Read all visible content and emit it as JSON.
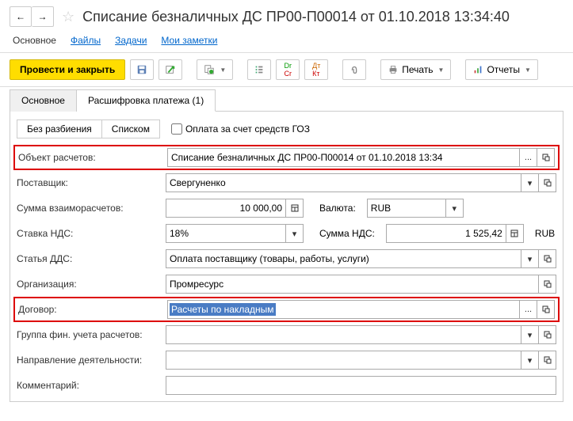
{
  "header": {
    "title": "Списание безналичных ДС ПР00-П00014 от 01.10.2018 13:34:40"
  },
  "top_tabs": {
    "main": "Основное",
    "files": "Файлы",
    "tasks": "Задачи",
    "notes": "Мои заметки"
  },
  "toolbar": {
    "post_close": "Провести и закрыть",
    "print": "Печать",
    "reports": "Отчеты"
  },
  "sub_tabs": {
    "main": "Основное",
    "decode": "Расшифровка платежа (1)"
  },
  "segment": {
    "no_split": "Без разбиения",
    "list": "Списком"
  },
  "checkbox_goz": "Оплата за счет средств ГОЗ",
  "fields": {
    "object_label": "Объект расчетов:",
    "object_value": "Списание безналичных ДС ПР00-П00014 от 01.10.2018 13:34",
    "supplier_label": "Поставщик:",
    "supplier_value": "Свергуненко",
    "amount_label": "Сумма взаиморасчетов:",
    "amount_value": "10 000,00",
    "currency_label": "Валюта:",
    "currency_value": "RUB",
    "vat_rate_label": "Ставка НДС:",
    "vat_rate_value": "18%",
    "vat_sum_label": "Сумма НДС:",
    "vat_sum_value": "1 525,42",
    "vat_currency": "RUB",
    "dds_label": "Статья ДДС:",
    "dds_value": "Оплата поставщику (товары, работы, услуги)",
    "org_label": "Организация:",
    "org_value": "Промресурс",
    "contract_label": "Договор:",
    "contract_value": "Расчеты по накладным",
    "fingroup_label": "Группа фин. учета расчетов:",
    "fingroup_value": "",
    "activity_label": "Направление деятельности:",
    "activity_value": "",
    "comment_label": "Комментарий:",
    "comment_value": ""
  }
}
